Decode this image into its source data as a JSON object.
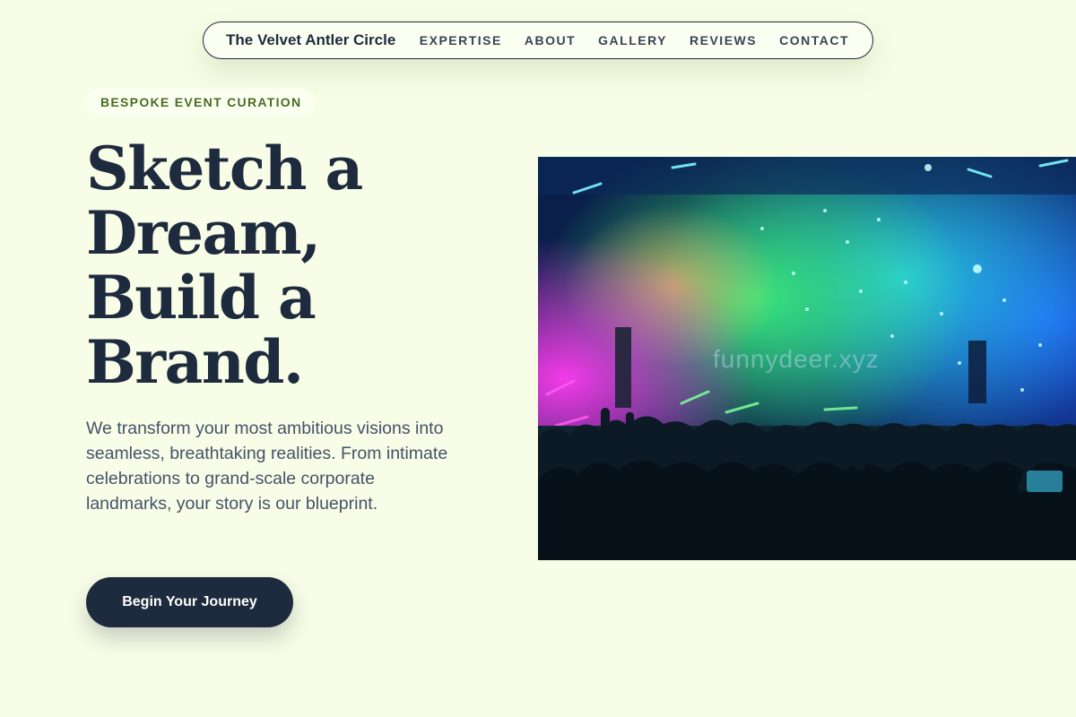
{
  "nav": {
    "brand": "The Velvet Antler Circle",
    "links": [
      "EXPERTISE",
      "ABOUT",
      "GALLERY",
      "REVIEWS",
      "CONTACT"
    ]
  },
  "hero": {
    "eyebrow": "BESPOKE EVENT CURATION",
    "headline_lines": [
      "Sketch a",
      "Dream,",
      "Build a",
      "Brand."
    ],
    "lede": "We transform your most ambitious visions into seamless, breathtaking realities. From intimate celebrations to grand-scale corporate landmarks, your story is our blueprint.",
    "cta_label": "Begin Your Journey",
    "image_watermark": "funnydeer.xyz"
  },
  "colors": {
    "background": "#f7fde6",
    "ink": "#1e2a3d",
    "eyebrow_text": "#4a6b25"
  },
  "icons": {
    "hero_image": "concert-crowd-photo"
  }
}
